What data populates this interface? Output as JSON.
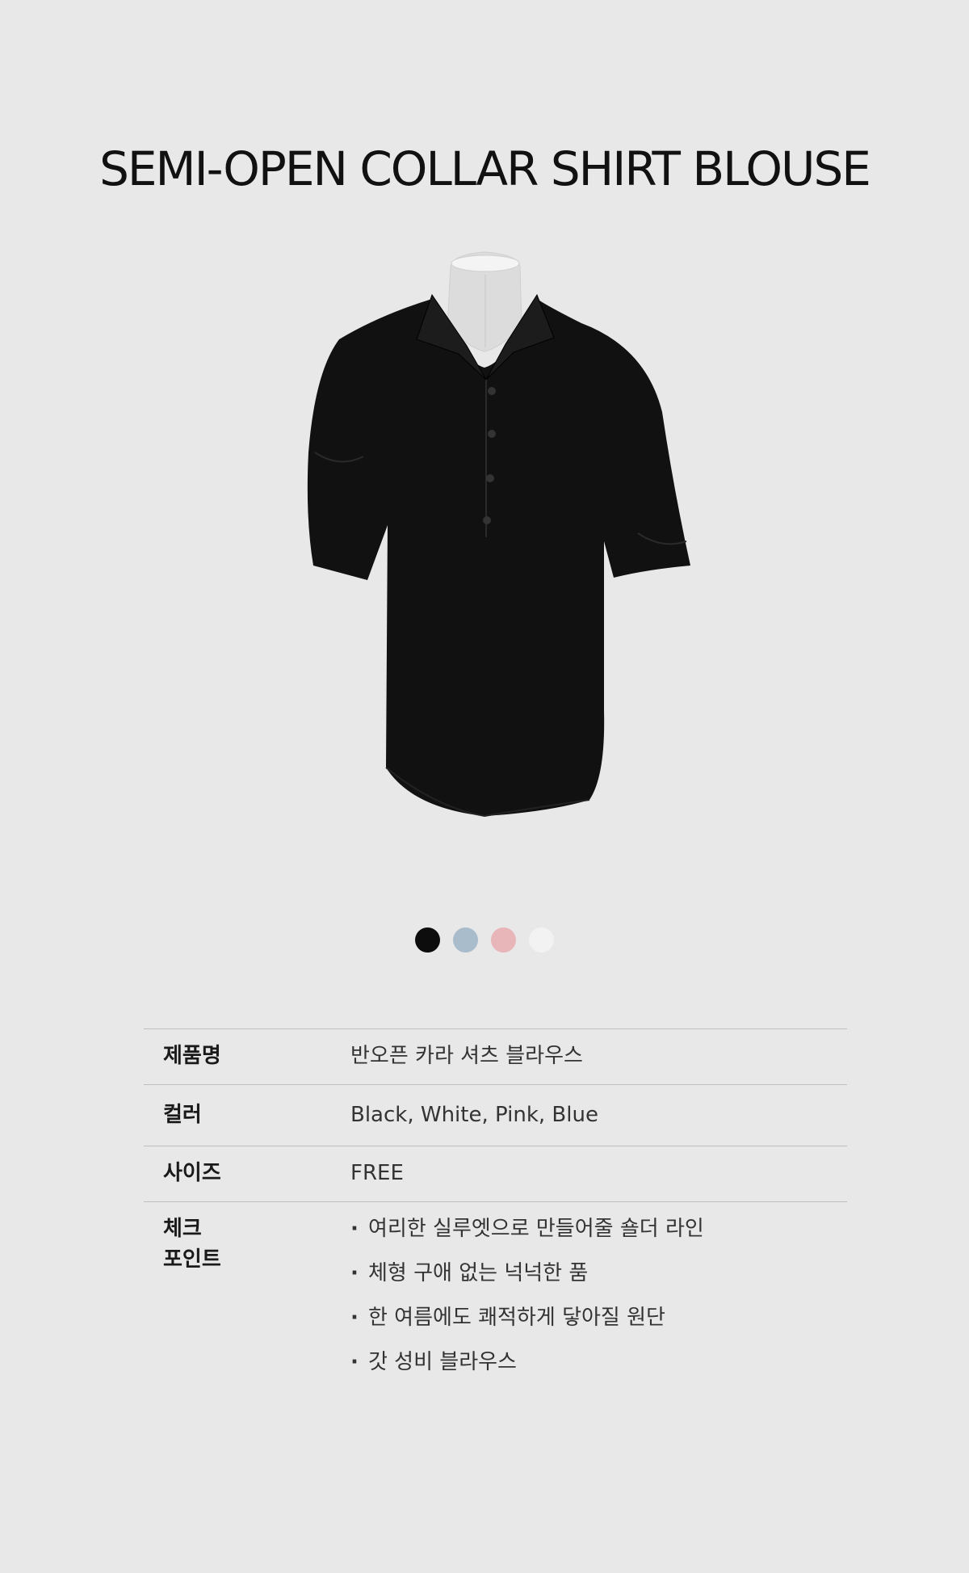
{
  "title": "SEMI-OPEN COLLAR SHIRT BLOUSE",
  "product_image": "black short-sleeve blouse on mannequin",
  "swatches": [
    {
      "name": "Black",
      "color": "#0d0d0d"
    },
    {
      "name": "Blue",
      "color": "#a9bccb"
    },
    {
      "name": "Pink",
      "color": "#e8b5b8"
    },
    {
      "name": "White",
      "color": "#f2f2f2"
    }
  ],
  "info": {
    "name_label": "제품명",
    "name_value": "반오픈 카라 셔츠 블라우스",
    "color_label": "컬러",
    "color_value": "Black, White, Pink, Blue",
    "size_label": "사이즈",
    "size_value": "FREE",
    "check_label": "체크\n포인트",
    "points": [
      "여리한 실루엣으로 만들어줄 숄더 라인",
      "체형 구애 없는 넉넉한 품",
      "한 여름에도 쾌적하게 닿아질 원단",
      "갓 성비 블라우스"
    ]
  }
}
